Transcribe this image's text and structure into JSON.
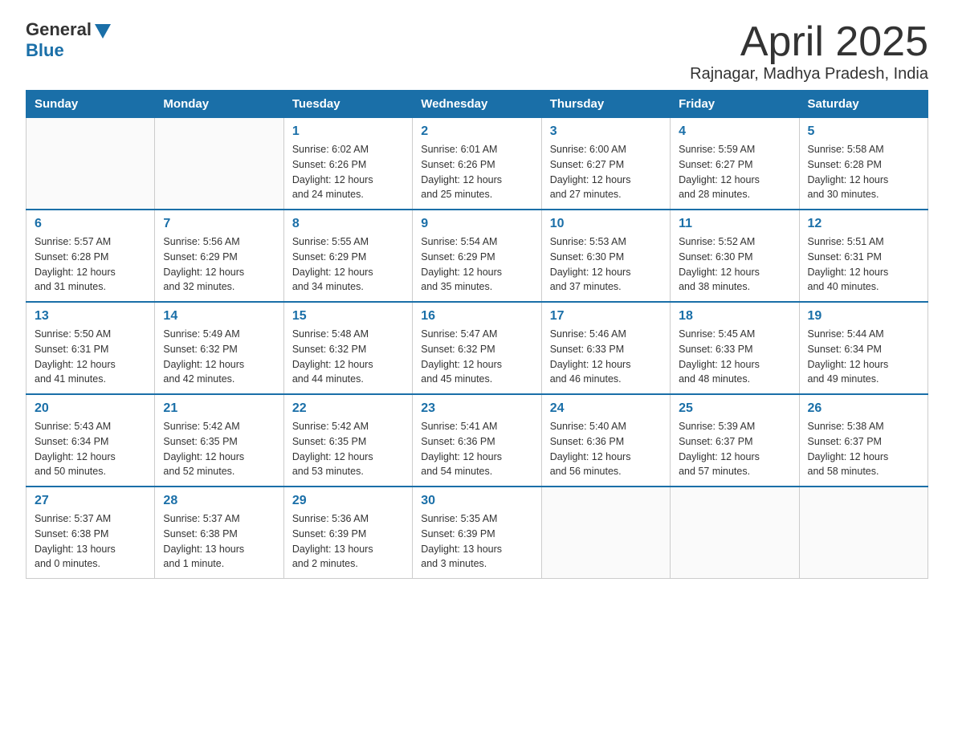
{
  "logo": {
    "general": "General",
    "blue": "Blue"
  },
  "header": {
    "title": "April 2025",
    "subtitle": "Rajnagar, Madhya Pradesh, India"
  },
  "weekdays": [
    "Sunday",
    "Monday",
    "Tuesday",
    "Wednesday",
    "Thursday",
    "Friday",
    "Saturday"
  ],
  "weeks": [
    [
      {
        "day": "",
        "info": ""
      },
      {
        "day": "",
        "info": ""
      },
      {
        "day": "1",
        "info": "Sunrise: 6:02 AM\nSunset: 6:26 PM\nDaylight: 12 hours\nand 24 minutes."
      },
      {
        "day": "2",
        "info": "Sunrise: 6:01 AM\nSunset: 6:26 PM\nDaylight: 12 hours\nand 25 minutes."
      },
      {
        "day": "3",
        "info": "Sunrise: 6:00 AM\nSunset: 6:27 PM\nDaylight: 12 hours\nand 27 minutes."
      },
      {
        "day": "4",
        "info": "Sunrise: 5:59 AM\nSunset: 6:27 PM\nDaylight: 12 hours\nand 28 minutes."
      },
      {
        "day": "5",
        "info": "Sunrise: 5:58 AM\nSunset: 6:28 PM\nDaylight: 12 hours\nand 30 minutes."
      }
    ],
    [
      {
        "day": "6",
        "info": "Sunrise: 5:57 AM\nSunset: 6:28 PM\nDaylight: 12 hours\nand 31 minutes."
      },
      {
        "day": "7",
        "info": "Sunrise: 5:56 AM\nSunset: 6:29 PM\nDaylight: 12 hours\nand 32 minutes."
      },
      {
        "day": "8",
        "info": "Sunrise: 5:55 AM\nSunset: 6:29 PM\nDaylight: 12 hours\nand 34 minutes."
      },
      {
        "day": "9",
        "info": "Sunrise: 5:54 AM\nSunset: 6:29 PM\nDaylight: 12 hours\nand 35 minutes."
      },
      {
        "day": "10",
        "info": "Sunrise: 5:53 AM\nSunset: 6:30 PM\nDaylight: 12 hours\nand 37 minutes."
      },
      {
        "day": "11",
        "info": "Sunrise: 5:52 AM\nSunset: 6:30 PM\nDaylight: 12 hours\nand 38 minutes."
      },
      {
        "day": "12",
        "info": "Sunrise: 5:51 AM\nSunset: 6:31 PM\nDaylight: 12 hours\nand 40 minutes."
      }
    ],
    [
      {
        "day": "13",
        "info": "Sunrise: 5:50 AM\nSunset: 6:31 PM\nDaylight: 12 hours\nand 41 minutes."
      },
      {
        "day": "14",
        "info": "Sunrise: 5:49 AM\nSunset: 6:32 PM\nDaylight: 12 hours\nand 42 minutes."
      },
      {
        "day": "15",
        "info": "Sunrise: 5:48 AM\nSunset: 6:32 PM\nDaylight: 12 hours\nand 44 minutes."
      },
      {
        "day": "16",
        "info": "Sunrise: 5:47 AM\nSunset: 6:32 PM\nDaylight: 12 hours\nand 45 minutes."
      },
      {
        "day": "17",
        "info": "Sunrise: 5:46 AM\nSunset: 6:33 PM\nDaylight: 12 hours\nand 46 minutes."
      },
      {
        "day": "18",
        "info": "Sunrise: 5:45 AM\nSunset: 6:33 PM\nDaylight: 12 hours\nand 48 minutes."
      },
      {
        "day": "19",
        "info": "Sunrise: 5:44 AM\nSunset: 6:34 PM\nDaylight: 12 hours\nand 49 minutes."
      }
    ],
    [
      {
        "day": "20",
        "info": "Sunrise: 5:43 AM\nSunset: 6:34 PM\nDaylight: 12 hours\nand 50 minutes."
      },
      {
        "day": "21",
        "info": "Sunrise: 5:42 AM\nSunset: 6:35 PM\nDaylight: 12 hours\nand 52 minutes."
      },
      {
        "day": "22",
        "info": "Sunrise: 5:42 AM\nSunset: 6:35 PM\nDaylight: 12 hours\nand 53 minutes."
      },
      {
        "day": "23",
        "info": "Sunrise: 5:41 AM\nSunset: 6:36 PM\nDaylight: 12 hours\nand 54 minutes."
      },
      {
        "day": "24",
        "info": "Sunrise: 5:40 AM\nSunset: 6:36 PM\nDaylight: 12 hours\nand 56 minutes."
      },
      {
        "day": "25",
        "info": "Sunrise: 5:39 AM\nSunset: 6:37 PM\nDaylight: 12 hours\nand 57 minutes."
      },
      {
        "day": "26",
        "info": "Sunrise: 5:38 AM\nSunset: 6:37 PM\nDaylight: 12 hours\nand 58 minutes."
      }
    ],
    [
      {
        "day": "27",
        "info": "Sunrise: 5:37 AM\nSunset: 6:38 PM\nDaylight: 13 hours\nand 0 minutes."
      },
      {
        "day": "28",
        "info": "Sunrise: 5:37 AM\nSunset: 6:38 PM\nDaylight: 13 hours\nand 1 minute."
      },
      {
        "day": "29",
        "info": "Sunrise: 5:36 AM\nSunset: 6:39 PM\nDaylight: 13 hours\nand 2 minutes."
      },
      {
        "day": "30",
        "info": "Sunrise: 5:35 AM\nSunset: 6:39 PM\nDaylight: 13 hours\nand 3 minutes."
      },
      {
        "day": "",
        "info": ""
      },
      {
        "day": "",
        "info": ""
      },
      {
        "day": "",
        "info": ""
      }
    ]
  ]
}
